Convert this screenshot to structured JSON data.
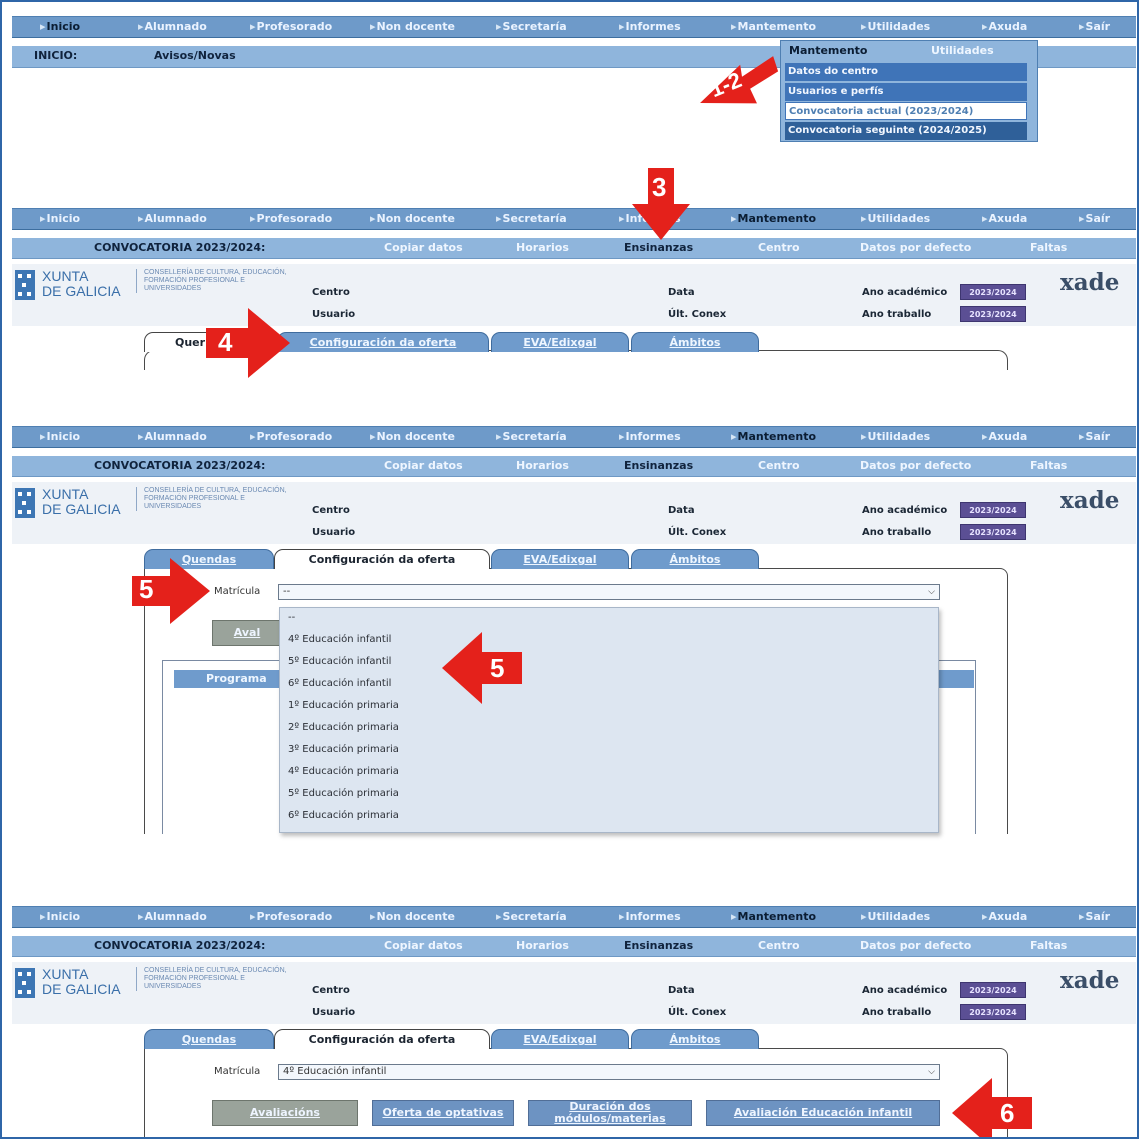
{
  "topnav": {
    "items": [
      "Inicio",
      "Alumnado",
      "Profesorado",
      "Non docente",
      "Secretaría",
      "Informes",
      "Mantemento",
      "Utilidades",
      "Axuda",
      "Saír"
    ]
  },
  "panel1": {
    "inicio_label": "INICIO:",
    "avisos_label": "Avisos/Novas",
    "menu_header": "Mantemento",
    "menu_header2": "Utilidades",
    "dropdown": [
      "Datos do centro",
      "Usuarios e perfís",
      "Convocatoria actual (2023/2024)",
      "Convocatoria seguinte (2024/2025)"
    ]
  },
  "subnav": {
    "title": "CONVOCATORIA 2023/2024:",
    "items": [
      "Copiar datos",
      "Horarios",
      "Ensinanzas",
      "Centro",
      "Datos por defecto",
      "Faltas"
    ]
  },
  "header": {
    "xunta_line1": "XUNTA",
    "xunta_line2": "DE GALICIA",
    "conselleria": "CONSELLERÍA DE CULTURA, EDUCACIÓN, FORMACIÓN PROFESIONAL E UNIVERSIDADES",
    "centro": "Centro",
    "usuario": "Usuario",
    "data": "Data",
    "ult_conex": "Últ. Conex",
    "ano_academico": "Ano académico",
    "ano_traballo": "Ano traballo",
    "ano_academico_value": "2023/2024",
    "ano_traballo_value": "2023/2024",
    "product": "xade"
  },
  "tabs": [
    "Quendas",
    "Configuración da oferta",
    "EVA/Edixgal",
    "Ámbitos"
  ],
  "tab_partial": "Quer",
  "matricula": {
    "label": "Matrícula",
    "empty_value": "--",
    "selected_value": "4º Educación infantil",
    "options": [
      "--",
      "4º Educación infantil",
      "5º Educación infantil",
      "6º Educación infantil",
      "1º Educación primaria",
      "2º Educación primaria",
      "3º Educación primaria",
      "4º Educación primaria",
      "5º Educación primaria",
      "6º Educación primaria"
    ]
  },
  "panel3": {
    "partial_button": "Aval",
    "partial_header": "Programa"
  },
  "buttons": {
    "avaliacions": "Avaliacións",
    "oferta_optativas": "Oferta de optativas",
    "duracion": "Duración dos módulos/materias",
    "avaliacion_infantil": "Avaliación Educación infantil"
  },
  "steps": {
    "s12": "1-2",
    "s3": "3",
    "s4": "4",
    "s5a": "5",
    "s5b": "5",
    "s6": "6"
  },
  "colors": {
    "nav_blue": "#6e9ac9",
    "subnav_blue": "#8fb5dc",
    "annotation_red": "#e4211b",
    "badge_purple": "#5b4f94"
  }
}
